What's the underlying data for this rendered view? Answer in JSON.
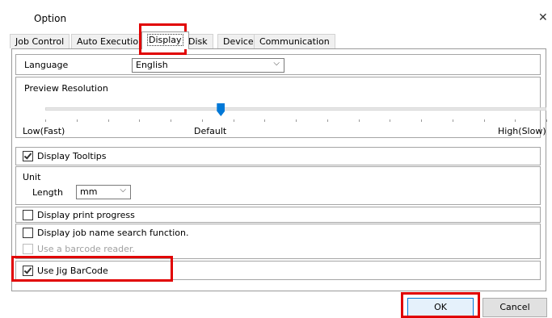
{
  "window": {
    "title": "Option",
    "close_glyph": "✕"
  },
  "tabs": [
    {
      "label": "Job Control"
    },
    {
      "label": "Auto Execution"
    },
    {
      "label": "Display"
    },
    {
      "label": "Disk"
    },
    {
      "label": "Device"
    },
    {
      "label": "Communication"
    }
  ],
  "active_tab": "Display",
  "language": {
    "label": "Language",
    "value": "English"
  },
  "preview_resolution": {
    "label": "Preview Resolution",
    "low_label": "Low(Fast)",
    "default_label": "Default",
    "high_label": "High(Slow)",
    "slider_fraction": 0.35,
    "tick_count": 17
  },
  "display_tooltips": {
    "label": "Display Tooltips",
    "checked": true
  },
  "unit": {
    "label": "Unit",
    "length_label": "Length",
    "length_value": "mm"
  },
  "display_print_progress": {
    "label": "Display print progress",
    "checked": false
  },
  "job_name_search": {
    "label": "Display job name search function.",
    "checked": false
  },
  "barcode_reader": {
    "label": "Use a barcode reader.",
    "checked": false,
    "enabled": false
  },
  "jig_barcode": {
    "label": "Use Jig BarCode",
    "checked": true
  },
  "buttons": {
    "ok": "OK",
    "cancel": "Cancel"
  },
  "colors": {
    "highlight": "#e10000",
    "slider_thumb": "#0078d7",
    "default_button_border": "#0078d7"
  },
  "icons": {
    "close": "close-icon",
    "dropdown": "chevron-down-icon",
    "check": "checkmark-icon"
  }
}
